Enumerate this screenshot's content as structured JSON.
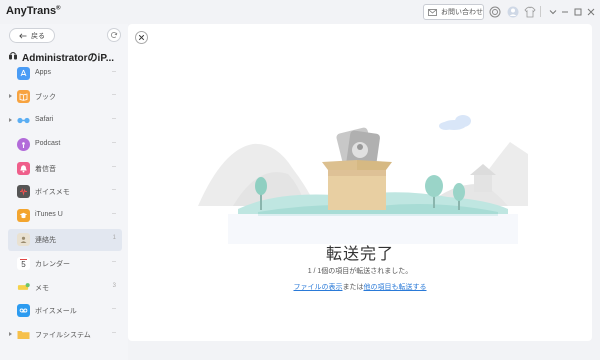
{
  "app": {
    "title": "AnyTrans",
    "trademark": "®"
  },
  "titlebar": {
    "contact_label": "お問い合わせ"
  },
  "sidebar": {
    "back_label": "戻る",
    "device_name": "AdministratorのiP...",
    "items": [
      {
        "label": "Apps",
        "count": "--",
        "icon": "apps-icon",
        "color": "#4a9cf5",
        "expandable": false
      },
      {
        "label": "ブック",
        "count": "--",
        "icon": "book-icon",
        "color": "#f7a340",
        "expandable": true
      },
      {
        "label": "Safari",
        "count": "--",
        "icon": "safari-icon",
        "color": "#5aaef3",
        "expandable": true
      },
      {
        "label": "Podcast",
        "count": "--",
        "icon": "podcast-icon",
        "color": "#b26bd9",
        "expandable": false
      },
      {
        "label": "着信音",
        "count": "--",
        "icon": "ringtone-icon",
        "color": "#ef5f8b",
        "expandable": false
      },
      {
        "label": "ボイスメモ",
        "count": "--",
        "icon": "voice-memo-icon",
        "color": "#555555",
        "expandable": false
      },
      {
        "label": "iTunes U",
        "count": "--",
        "icon": "itunes-u-icon",
        "color": "#f3a52f",
        "expandable": false
      },
      {
        "label": "連絡先",
        "count": "1",
        "icon": "contacts-icon",
        "color": "#c8b99a",
        "expandable": false
      },
      {
        "label": "カレンダー",
        "count": "--",
        "icon": "calendar-icon",
        "color": "#e04545",
        "expandable": false
      },
      {
        "label": "メモ",
        "count": "3",
        "icon": "notes-icon",
        "color": "#f5d24a",
        "expandable": false
      },
      {
        "label": "ボイスメール",
        "count": "--",
        "icon": "voicemail-icon",
        "color": "#2c9bf0",
        "expandable": false
      },
      {
        "label": "ファイルシステム",
        "count": "--",
        "icon": "filesystem-icon",
        "color": "#f6c04b",
        "expandable": true
      }
    ]
  },
  "main": {
    "title": "転送完了",
    "description": "1 / 1個の項目が転送されました。",
    "link_show_files": "ファイルの表示",
    "link_separator": "または",
    "link_transfer_other": "他の項目も転送する"
  }
}
